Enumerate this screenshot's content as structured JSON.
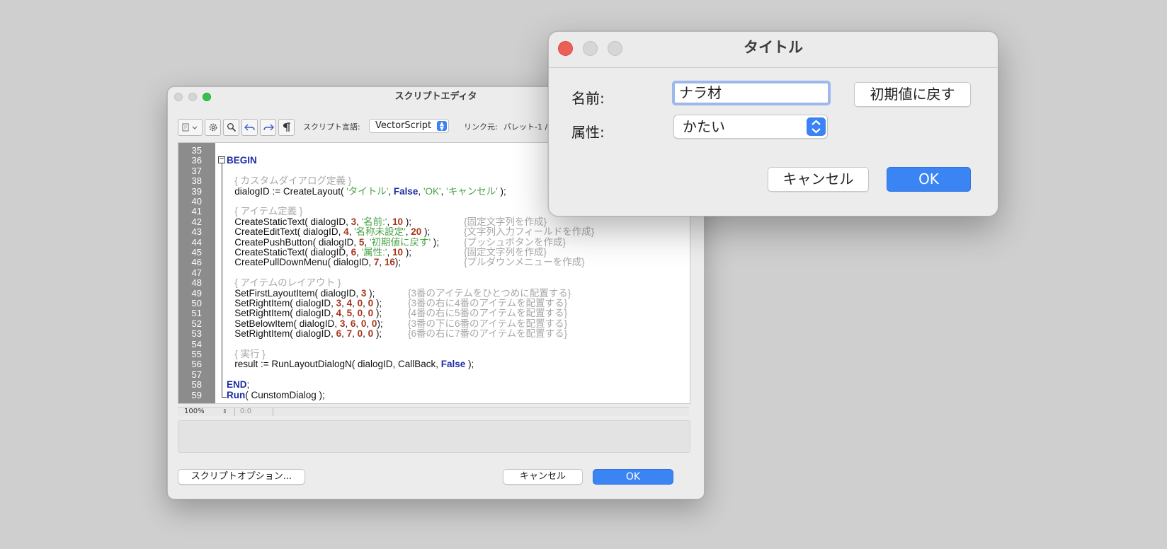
{
  "editor": {
    "title": "スクリプトエディタ",
    "toolbar": {
      "language_label": "スクリプト言語:",
      "language_value": "VectorScript",
      "link_label": "リンク元:",
      "link_value": "パレット-1 /"
    },
    "gutter_numbers": [
      "35",
      "36",
      "37",
      "38",
      "39",
      "40",
      "41",
      "42",
      "43",
      "44",
      "45",
      "46",
      "47",
      "48",
      "49",
      "50",
      "51",
      "52",
      "53",
      "54",
      "55",
      "56",
      "57",
      "58",
      "59"
    ],
    "status": {
      "zoom": "100%",
      "position": "0:0"
    },
    "buttons": {
      "options": "スクリプトオプション...",
      "cancel": "キャンセル",
      "ok": "OK"
    }
  },
  "code_lines": [
    [],
    [
      {
        "t": "BEGIN",
        "c": "kw"
      }
    ],
    [],
    [
      {
        "t": "   { カスタムダイアログ定義 }",
        "c": "cmt"
      }
    ],
    [
      {
        "t": "   dialogID := CreateLayout( ",
        "c": ""
      },
      {
        "t": "'タイトル'",
        "c": "str"
      },
      {
        "t": ", ",
        "c": ""
      },
      {
        "t": "False",
        "c": "kw"
      },
      {
        "t": ", ",
        "c": ""
      },
      {
        "t": "'OK'",
        "c": "str"
      },
      {
        "t": ", ",
        "c": ""
      },
      {
        "t": "'キャンセル'",
        "c": "str"
      },
      {
        "t": " );",
        "c": ""
      }
    ],
    [],
    [
      {
        "t": "   { アイテム定義 }",
        "c": "cmt"
      }
    ],
    [
      {
        "t": "   CreateStaticText( dialogID, ",
        "c": ""
      },
      {
        "t": "3",
        "c": "num"
      },
      {
        "t": ", ",
        "c": ""
      },
      {
        "t": "'名前:'",
        "c": "str"
      },
      {
        "t": ", ",
        "c": ""
      },
      {
        "t": "10",
        "c": "num"
      },
      {
        "t": " );",
        "c": ""
      }
    ],
    [
      {
        "t": "   CreateEditText( dialogID, ",
        "c": ""
      },
      {
        "t": "4",
        "c": "num"
      },
      {
        "t": ", ",
        "c": ""
      },
      {
        "t": "'名称未設定'",
        "c": "str"
      },
      {
        "t": ", ",
        "c": ""
      },
      {
        "t": "20",
        "c": "num"
      },
      {
        "t": " );",
        "c": ""
      }
    ],
    [
      {
        "t": "   CreatePushButton( dialogID, ",
        "c": ""
      },
      {
        "t": "5",
        "c": "num"
      },
      {
        "t": ", ",
        "c": ""
      },
      {
        "t": "'初期値に戻す'",
        "c": "str"
      },
      {
        "t": " );",
        "c": ""
      }
    ],
    [
      {
        "t": "   CreateStaticText( dialogID, ",
        "c": ""
      },
      {
        "t": "6",
        "c": "num"
      },
      {
        "t": ", ",
        "c": ""
      },
      {
        "t": "'属性:'",
        "c": "str"
      },
      {
        "t": ", ",
        "c": ""
      },
      {
        "t": "10",
        "c": "num"
      },
      {
        "t": " );",
        "c": ""
      }
    ],
    [
      {
        "t": "   CreatePullDownMenu( dialogID, ",
        "c": ""
      },
      {
        "t": "7",
        "c": "num"
      },
      {
        "t": ", ",
        "c": ""
      },
      {
        "t": "16",
        "c": "num"
      },
      {
        "t": ");",
        "c": ""
      }
    ],
    [],
    [
      {
        "t": "   { アイテムのレイアウト }",
        "c": "cmt"
      }
    ],
    [
      {
        "t": "   SetFirstLayoutItem( dialogID, ",
        "c": ""
      },
      {
        "t": "3",
        "c": "num"
      },
      {
        "t": " );",
        "c": ""
      }
    ],
    [
      {
        "t": "   SetRightItem( dialogID, ",
        "c": ""
      },
      {
        "t": "3",
        "c": "num"
      },
      {
        "t": ", ",
        "c": ""
      },
      {
        "t": "4",
        "c": "num"
      },
      {
        "t": ", ",
        "c": ""
      },
      {
        "t": "0",
        "c": "num"
      },
      {
        "t": ", ",
        "c": ""
      },
      {
        "t": "0",
        "c": "num"
      },
      {
        "t": " );",
        "c": ""
      }
    ],
    [
      {
        "t": "   SetRightItem( dialogID, ",
        "c": ""
      },
      {
        "t": "4",
        "c": "num"
      },
      {
        "t": ", ",
        "c": ""
      },
      {
        "t": "5",
        "c": "num"
      },
      {
        "t": ", ",
        "c": ""
      },
      {
        "t": "0",
        "c": "num"
      },
      {
        "t": ", ",
        "c": ""
      },
      {
        "t": "0",
        "c": "num"
      },
      {
        "t": " );",
        "c": ""
      }
    ],
    [
      {
        "t": "   SetBelowItem( dialogID, ",
        "c": ""
      },
      {
        "t": "3",
        "c": "num"
      },
      {
        "t": ", ",
        "c": ""
      },
      {
        "t": "6",
        "c": "num"
      },
      {
        "t": ", ",
        "c": ""
      },
      {
        "t": "0",
        "c": "num"
      },
      {
        "t": ", ",
        "c": ""
      },
      {
        "t": "0",
        "c": "num"
      },
      {
        "t": ");",
        "c": ""
      }
    ],
    [
      {
        "t": "   SetRightItem( dialogID, ",
        "c": ""
      },
      {
        "t": "6",
        "c": "num"
      },
      {
        "t": ", ",
        "c": ""
      },
      {
        "t": "7",
        "c": "num"
      },
      {
        "t": ", ",
        "c": ""
      },
      {
        "t": "0",
        "c": "num"
      },
      {
        "t": ", ",
        "c": ""
      },
      {
        "t": "0",
        "c": "num"
      },
      {
        "t": " );",
        "c": ""
      }
    ],
    [],
    [
      {
        "t": "   { 実行 }",
        "c": "cmt"
      }
    ],
    [
      {
        "t": "   result := RunLayoutDialogN( dialogID, CallBack, ",
        "c": ""
      },
      {
        "t": "False",
        "c": "kw"
      },
      {
        "t": " );",
        "c": ""
      }
    ],
    [],
    [
      {
        "t": "END",
        "c": "kw"
      },
      {
        "t": ";",
        "c": ""
      }
    ],
    [
      {
        "t": "Run",
        "c": "kw"
      },
      {
        "t": "( CunstomDialog );",
        "c": ""
      }
    ]
  ],
  "code_comments": [
    {
      "line": 7,
      "col": "a",
      "text": "{固定文字列を作成}"
    },
    {
      "line": 8,
      "col": "a",
      "text": "{文字列入力フィールドを作成}"
    },
    {
      "line": 9,
      "col": "a",
      "text": "{プッシュボタンを作成}"
    },
    {
      "line": 10,
      "col": "a",
      "text": "{固定文字列を作成}"
    },
    {
      "line": 11,
      "col": "a",
      "text": "{プルダウンメニューを作成}"
    },
    {
      "line": 14,
      "col": "b",
      "text": "{3番のアイテムをひとつめに配置する}"
    },
    {
      "line": 15,
      "col": "b",
      "text": "{3番の右に4番のアイテムを配置する}"
    },
    {
      "line": 16,
      "col": "b",
      "text": "{4番の右に5番のアイテムを配置する}"
    },
    {
      "line": 17,
      "col": "b",
      "text": "{3番の下に6番のアイテムを配置する}"
    },
    {
      "line": 18,
      "col": "b",
      "text": "{6番の右に7番のアイテムを配置する}"
    }
  ],
  "dialog": {
    "title": "タイトル",
    "name_label": "名前:",
    "name_value": "ナラ材",
    "reset_button": "初期値に戻す",
    "attr_label": "属性:",
    "attr_value": "かたい",
    "cancel_button": "キャンセル",
    "ok_button": "OK"
  },
  "colors": {
    "keyword": "#1c2da4",
    "number": "#a8371d",
    "string": "#49a347",
    "comment": "#a8a8a8",
    "accent": "#3b84f4",
    "close_red": "#ec5f57",
    "zoom_green": "#36c14a"
  }
}
